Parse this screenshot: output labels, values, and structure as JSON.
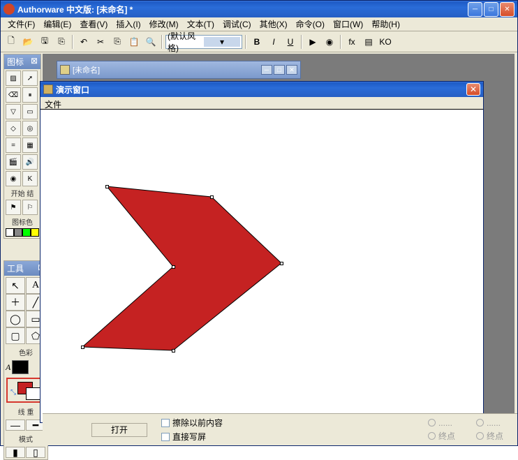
{
  "app": {
    "title": "Authorware 中文版: [未命名] *"
  },
  "menu": [
    "文件(F)",
    "编辑(E)",
    "查看(V)",
    "插入(I)",
    "修改(M)",
    "文本(T)",
    "调试(C)",
    "其他(X)",
    "命令(O)",
    "窗口(W)",
    "帮助(H)"
  ],
  "toolbar": {
    "style_label": "(默认风格)"
  },
  "icon_palette": {
    "title": "图标",
    "start_label": "开始 结",
    "color_label": "图标色"
  },
  "tool_palette": {
    "title": "工具",
    "color_label": "色彩",
    "line_label": "线 重",
    "mode_label": "模式"
  },
  "child_window": {
    "title": "[未命名]"
  },
  "pres_window": {
    "title": "演示窗口",
    "menu_file": "文件"
  },
  "bottom": {
    "open": "打开",
    "erase": "擦除以前内容",
    "direct": "直接写屏",
    "endpoint": "终点",
    "something": "......"
  }
}
